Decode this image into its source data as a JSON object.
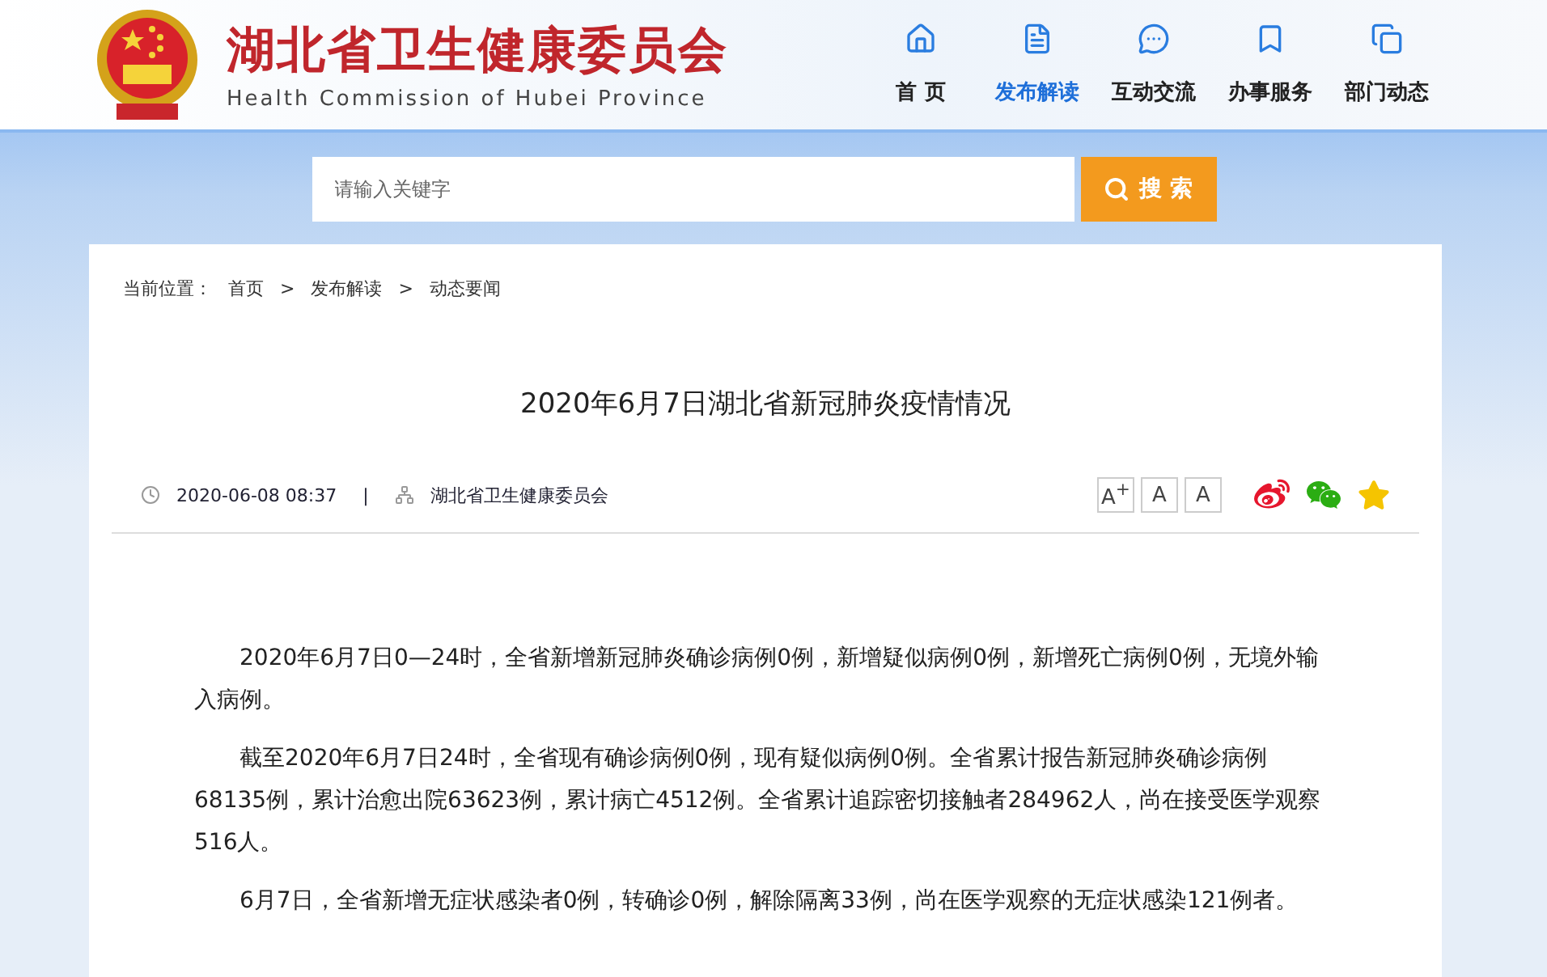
{
  "header": {
    "title": "湖北省卫生健康委员会",
    "subtitle": "Health Commission of Hubei Province",
    "nav": [
      {
        "label": "首 页",
        "selected": false
      },
      {
        "label": "发布解读",
        "selected": true
      },
      {
        "label": "互动交流",
        "selected": false
      },
      {
        "label": "办事服务",
        "selected": false
      },
      {
        "label": "部门动态",
        "selected": false
      }
    ]
  },
  "search": {
    "placeholder": "请输入关键字",
    "button": "搜 索"
  },
  "breadcrumb": {
    "label": "当前位置：",
    "items": [
      "首页",
      "发布解读",
      "动态要闻"
    ],
    "separator": ">"
  },
  "article": {
    "title": "2020年6月7日湖北省新冠肺炎疫情情况",
    "date": "2020-06-08 08:37",
    "separator": "|",
    "source": "湖北省卫生健康委员会",
    "font_buttons": [
      "A$^{+}$",
      "A",
      "A"
    ],
    "paragraphs": [
      "2020年6月7日0—24时，全省新增新冠肺炎确诊病例0例，新增疑似病例0例，新增死亡病例0例，无境外输入病例。",
      "截至2020年6月7日24时，全省现有确诊病例0例，现有疑似病例0例。全省累计报告新冠肺炎确诊病例68135例，累计治愈出院63623例，累计病亡4512例。全省累计追踪密切接触者284962人，尚在接受医学观察516人。",
      "6月7日，全省新增无症状感染者0例，转确诊0例，解除隔离33例，尚在医学观察的无症状感染121例者。"
    ]
  }
}
